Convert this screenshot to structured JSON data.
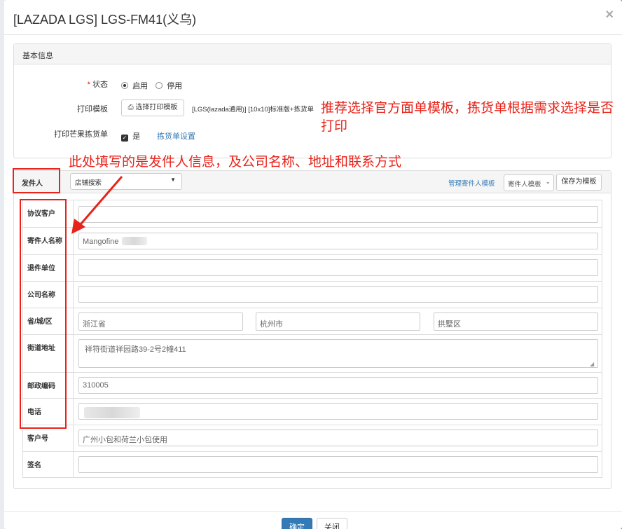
{
  "modal": {
    "title": "[LAZADA LGS] LGS-FM41(义乌)",
    "close": "×"
  },
  "basic": {
    "heading": "基本信息",
    "status_label": "状态",
    "required_mark": "*",
    "status_on": "启用",
    "status_off": "停用",
    "print_template_label": "打印模板",
    "select_template_btn": "选择打印模板",
    "template_value": "[LGS(lazada通用)] [10x10]标准版+拣货单",
    "print_pick_label": "打印芒果拣货单",
    "print_pick_yes": "是",
    "pick_settings_link": "拣货单设置"
  },
  "annotations": {
    "tip1": "推荐选择官方面单模板，拣货单根据需求选择是否打印",
    "tip2": "此处填写的是发件人信息，及公司名称、地址和联系方式"
  },
  "sender": {
    "heading": "发件人",
    "store_search": "店铺搜索",
    "manage_link": "管理寄件人模板",
    "template_select": "寄件人模板",
    "save_btn": "保存为模板",
    "rows": {
      "agreement_customer": {
        "label": "协议客户",
        "value": ""
      },
      "sender_name": {
        "label": "寄件人名称",
        "value": "Mangofine"
      },
      "return_unit": {
        "label": "退件单位",
        "value": ""
      },
      "company_name": {
        "label": "公司名称",
        "value": ""
      },
      "region": {
        "label": "省/城/区",
        "province": "浙江省",
        "city": "杭州市",
        "district": "拱墅区"
      },
      "street": {
        "label": "街道地址",
        "value": "祥符街道祥园路39-2号2幢411"
      },
      "postcode": {
        "label": "邮政编码",
        "value": "310005"
      },
      "phone": {
        "label": "电话",
        "value": ""
      },
      "customer_no": {
        "label": "客户号",
        "value": "广州小包和荷兰小包使用"
      },
      "signature": {
        "label": "签名",
        "value": ""
      }
    }
  },
  "footer": {
    "confirm": "确定",
    "close": "关闭"
  },
  "colors": {
    "annotation_red": "#e8231a",
    "primary_blue": "#337ab7"
  }
}
